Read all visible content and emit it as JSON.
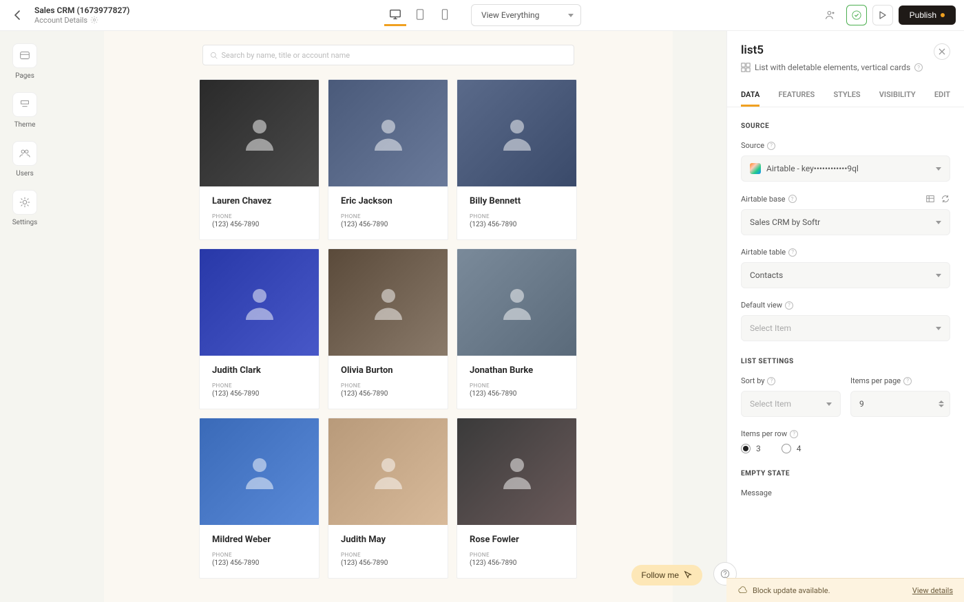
{
  "header": {
    "project_title": "Sales CRM (1673977827)",
    "page_subtitle": "Account Details",
    "view_label": "View Everything",
    "publish_label": "Publish"
  },
  "sidebar": {
    "items": [
      {
        "label": "Pages"
      },
      {
        "label": "Theme"
      },
      {
        "label": "Users"
      },
      {
        "label": "Settings"
      }
    ]
  },
  "search": {
    "placeholder": "Search by name, title or account name"
  },
  "contacts": [
    {
      "name": "Lauren Chavez",
      "phone_label": "PHONE",
      "phone": "(123) 456-7890"
    },
    {
      "name": "Eric Jackson",
      "phone_label": "PHONE",
      "phone": "(123) 456-7890"
    },
    {
      "name": "Billy Bennett",
      "phone_label": "PHONE",
      "phone": "(123) 456-7890"
    },
    {
      "name": "Judith Clark",
      "phone_label": "PHONE",
      "phone": "(123) 456-7890"
    },
    {
      "name": "Olivia Burton",
      "phone_label": "PHONE",
      "phone": "(123) 456-7890"
    },
    {
      "name": "Jonathan Burke",
      "phone_label": "PHONE",
      "phone": "(123) 456-7890"
    },
    {
      "name": "Mildred Weber",
      "phone_label": "PHONE",
      "phone": "(123) 456-7890"
    },
    {
      "name": "Judith May",
      "phone_label": "PHONE",
      "phone": "(123) 456-7890"
    },
    {
      "name": "Rose Fowler",
      "phone_label": "PHONE",
      "phone": "(123) 456-7890"
    }
  ],
  "panel": {
    "title": "list5",
    "description": "List with deletable elements, vertical cards",
    "tabs": {
      "data": "DATA",
      "features": "FEATURES",
      "styles": "STYLES",
      "visibility": "VISIBILITY",
      "edit": "EDIT"
    },
    "source_heading": "SOURCE",
    "source_label": "Source",
    "source_value": "Airtable - key••••••••••••9ql",
    "base_label": "Airtable base",
    "base_value": "Sales CRM by Softr",
    "table_label": "Airtable table",
    "table_value": "Contacts",
    "default_view_label": "Default view",
    "default_view_placeholder": "Select Item",
    "list_settings_heading": "LIST SETTINGS",
    "sort_by_label": "Sort by",
    "sort_by_placeholder": "Select Item",
    "items_per_page_label": "Items per page",
    "items_per_page_value": "9",
    "items_per_row_label": "Items per row",
    "items_per_row_options": {
      "opt3": "3",
      "opt4": "4"
    },
    "empty_state_heading": "EMPTY STATE",
    "message_label": "Message"
  },
  "float": {
    "follow_label": "Follow me"
  },
  "banner": {
    "text": "Block update available.",
    "link": "View details"
  }
}
